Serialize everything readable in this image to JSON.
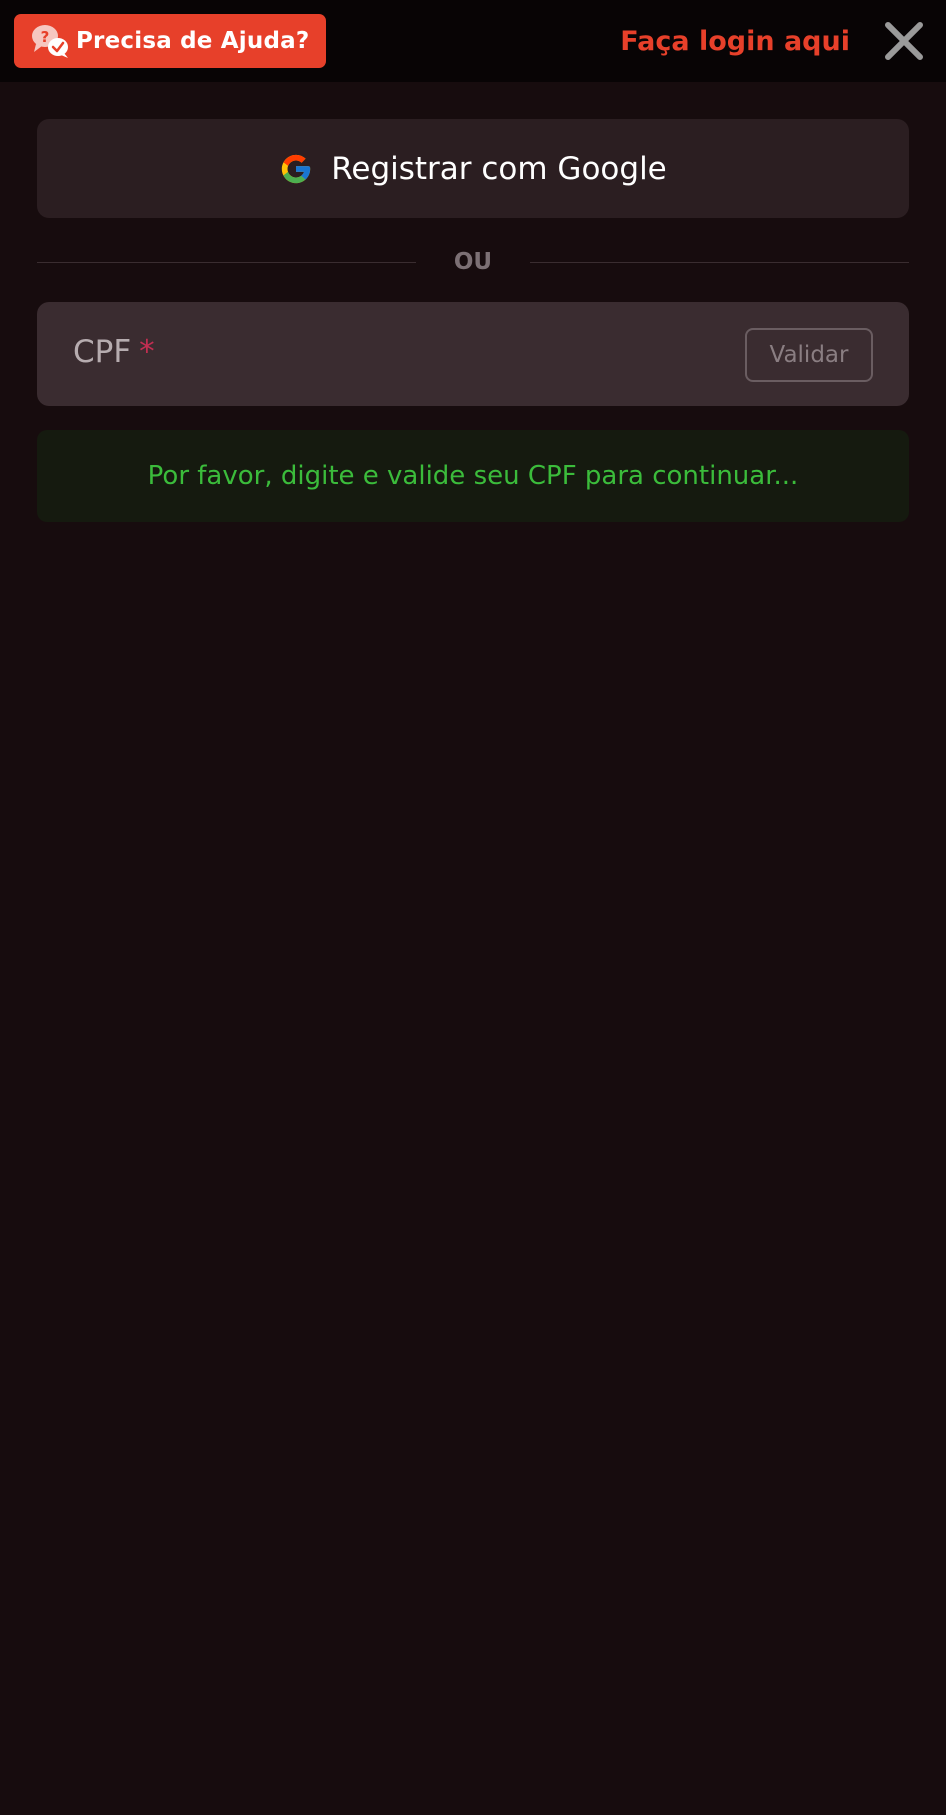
{
  "header": {
    "help_label": "Precisa de Ajuda?",
    "login_link": "Faça login aqui"
  },
  "google": {
    "label": "Registrar com Google"
  },
  "divider": {
    "text": "OU"
  },
  "cpf": {
    "label": "CPF",
    "required_mark": "*",
    "value": "",
    "validate_label": "Validar"
  },
  "notice": {
    "text": "Por favor, digite e valide seu CPF para continuar..."
  },
  "colors": {
    "accent": "#e7402a",
    "background": "#170c0e",
    "notice_text": "#3bbc3b",
    "required": "#c42e52"
  },
  "icons": {
    "help": "chat-question-icon",
    "close": "close-icon",
    "google": "google-icon"
  }
}
